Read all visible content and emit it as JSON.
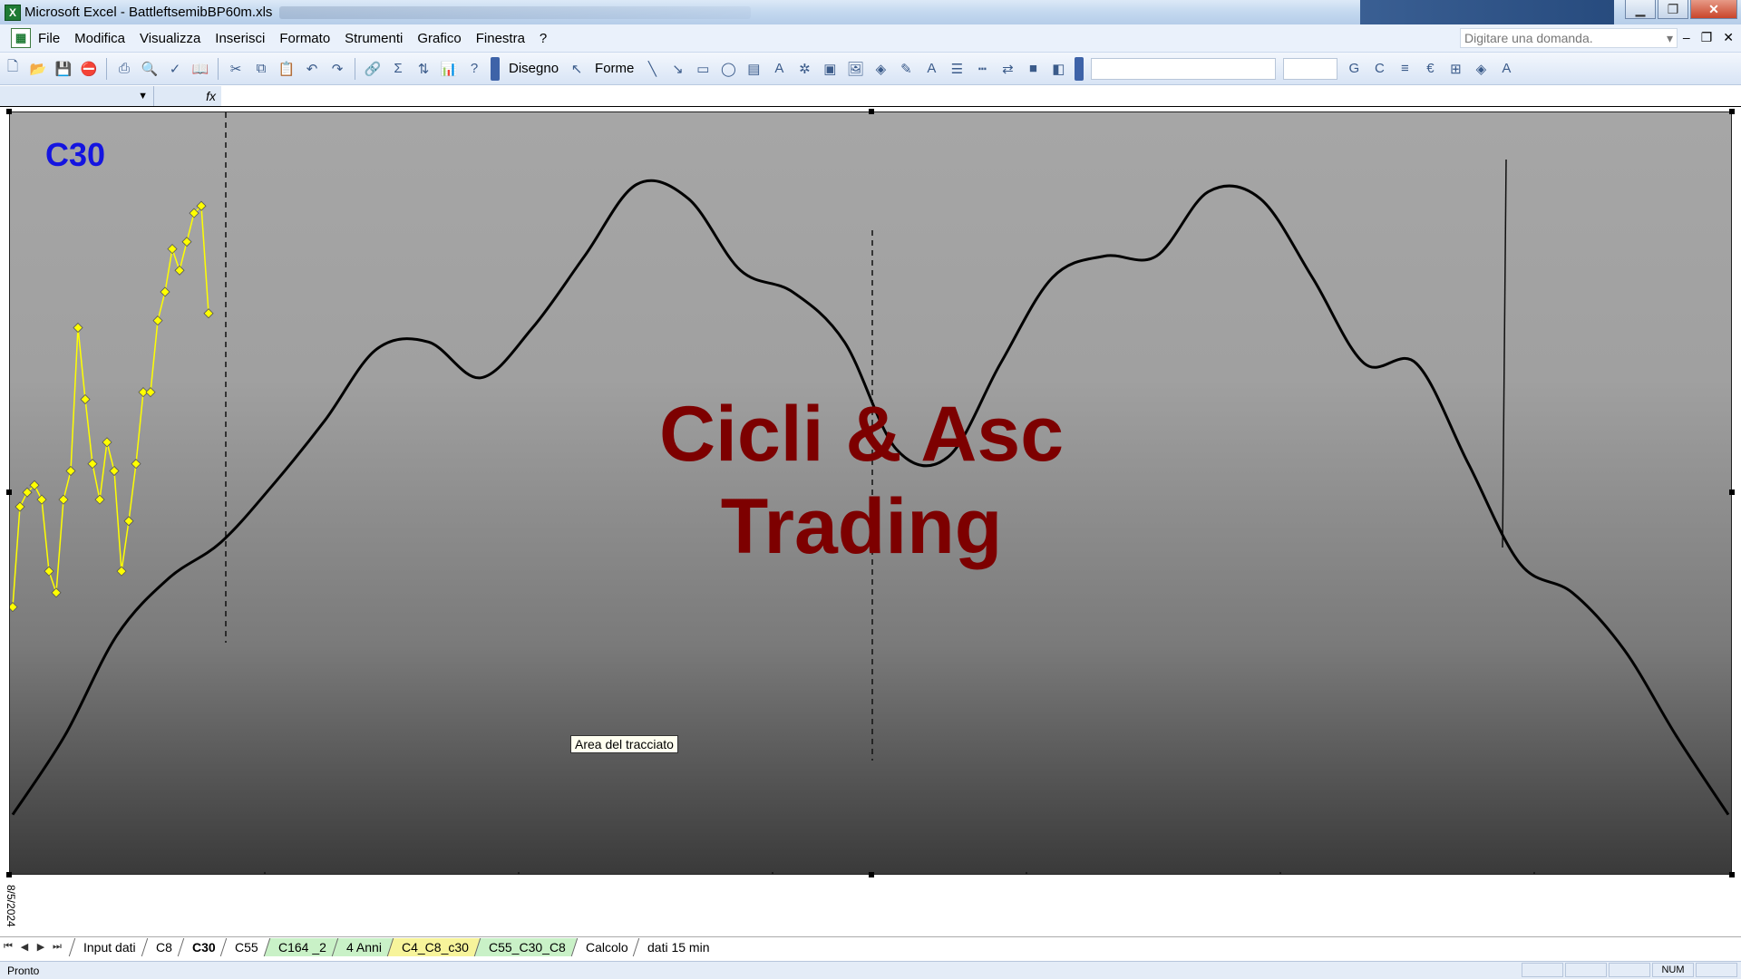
{
  "window": {
    "title": "Microsoft Excel - BattleftsemibBP60m.xls",
    "app_icon_letter": "X"
  },
  "menu": {
    "items": [
      "File",
      "Modifica",
      "Visualizza",
      "Inserisci",
      "Formato",
      "Strumenti",
      "Grafico",
      "Finestra",
      "?"
    ],
    "ask_placeholder": "Digitare una domanda."
  },
  "toolbar": {
    "drawing_label": "Disegno",
    "shapes_label": "Forme"
  },
  "formula": {
    "fx_label": "fx"
  },
  "chart": {
    "label": "C30",
    "watermark_line1": "Cicli & Asc",
    "watermark_line2": "Trading",
    "tooltip": "Area del tracciato",
    "x_axis_date": "8/5/2024"
  },
  "chart_data": {
    "type": "line",
    "series": [
      {
        "color": "#ffff00",
        "marker": "diamond",
        "values": [
          0.36,
          0.5,
          0.52,
          0.53,
          0.51,
          0.41,
          0.38,
          0.51,
          0.55,
          0.75,
          0.65,
          0.56,
          0.51,
          0.59,
          0.55,
          0.41,
          0.48,
          0.56,
          0.66,
          0.66,
          0.76,
          0.8,
          0.86,
          0.83,
          0.87,
          0.91,
          0.92,
          0.77
        ]
      },
      {
        "color": "#000000",
        "marker": "none",
        "values": [
          0.07,
          0.18,
          0.32,
          0.4,
          0.45,
          0.53,
          0.62,
          0.72,
          0.73,
          0.68,
          0.75,
          0.85,
          0.95,
          0.93,
          0.83,
          0.8,
          0.73,
          0.58,
          0.57,
          0.7,
          0.82,
          0.85,
          0.85,
          0.94,
          0.93,
          0.82,
          0.7,
          0.7,
          0.56,
          0.42,
          0.38,
          0.3,
          0.18,
          0.07
        ]
      }
    ],
    "vertical_markers": [
      "dashed",
      "dashed",
      "solid"
    ]
  },
  "sheet_tabs": [
    {
      "label": "Input dati",
      "style": "plain"
    },
    {
      "label": "C8",
      "style": "plain"
    },
    {
      "label": "C30",
      "style": "active"
    },
    {
      "label": "C55",
      "style": "plain"
    },
    {
      "label": "C164 _2",
      "style": "green"
    },
    {
      "label": "4 Anni",
      "style": "green"
    },
    {
      "label": "C4_C8_c30",
      "style": "yellow"
    },
    {
      "label": "C55_C30_C8",
      "style": "green"
    },
    {
      "label": "Calcolo",
      "style": "plain"
    },
    {
      "label": "dati 15 min",
      "style": "plain"
    }
  ],
  "status": {
    "text": "Pronto",
    "num_indicator": "NUM"
  }
}
